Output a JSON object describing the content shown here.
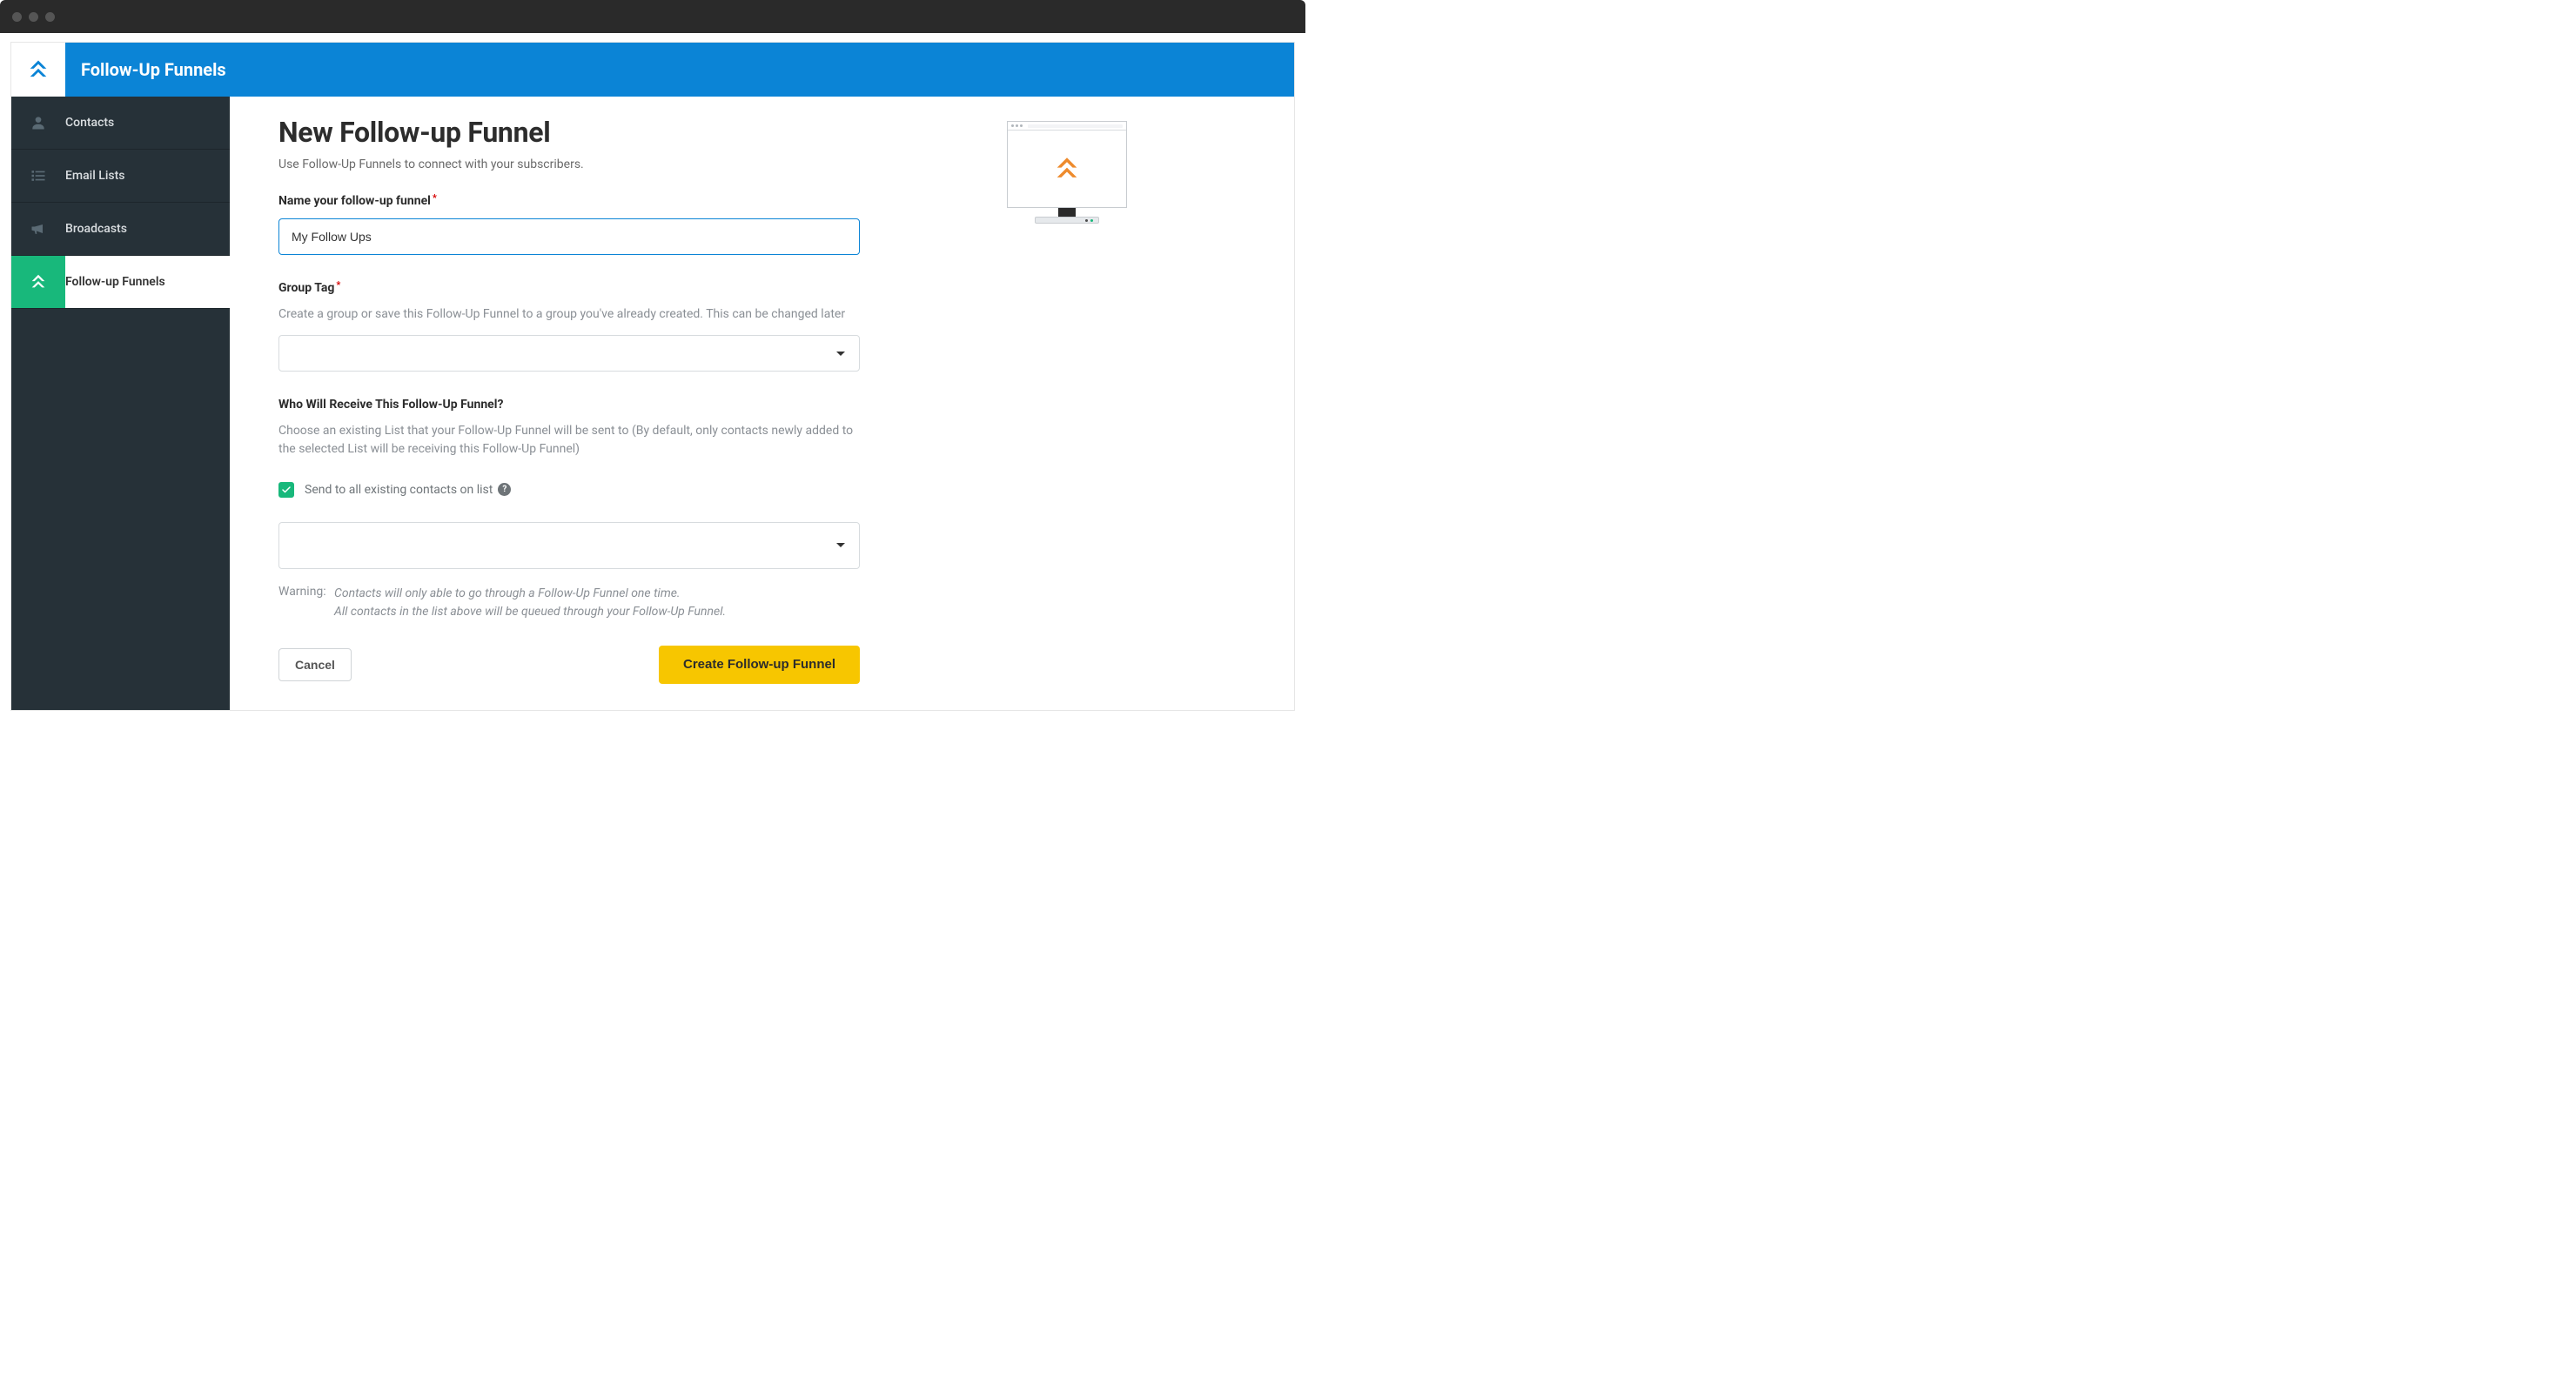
{
  "header": {
    "title": "Follow-Up Funnels"
  },
  "sidebar": {
    "items": [
      {
        "label": "Contacts",
        "icon": "person-icon",
        "active": false
      },
      {
        "label": "Email Lists",
        "icon": "list-icon",
        "active": false
      },
      {
        "label": "Broadcasts",
        "icon": "megaphone-icon",
        "active": false
      },
      {
        "label": "Follow-up Funnels",
        "icon": "chevrons-up-icon",
        "active": true
      }
    ]
  },
  "main": {
    "title": "New Follow-up Funnel",
    "subtitle": "Use Follow-Up Funnels to connect with your subscribers.",
    "name_field": {
      "label": "Name your follow-up funnel",
      "required": true,
      "value": "My Follow Ups"
    },
    "group_tag": {
      "label": "Group Tag",
      "required": true,
      "help": "Create a group or save this Follow-Up Funnel to a group you've already created. This can be changed later",
      "value": ""
    },
    "recipients": {
      "label": "Who Will Receive This Follow-Up Funnel?",
      "help": "Choose an existing List that your Follow-Up Funnel will be sent to (By default, only contacts newly added to the selected List will be receiving this Follow-Up Funnel)",
      "send_all_checkbox_label": "Send to all existing contacts on list",
      "send_all_checked": true,
      "list_value": ""
    },
    "warning": {
      "label": "Warning:",
      "line1": "Contacts will only able to go through a Follow-Up Funnel one time.",
      "line2": "All contacts in the list above will be queued through your Follow-Up Funnel."
    },
    "buttons": {
      "cancel": "Cancel",
      "create": "Create Follow-up Funnel"
    }
  },
  "icons": {
    "help_glyph": "?"
  },
  "colors": {
    "brand_blue": "#0b84d6",
    "brand_green": "#18b87b",
    "cta_yellow": "#f7c600",
    "orange_logo": "#ee8b2d"
  }
}
